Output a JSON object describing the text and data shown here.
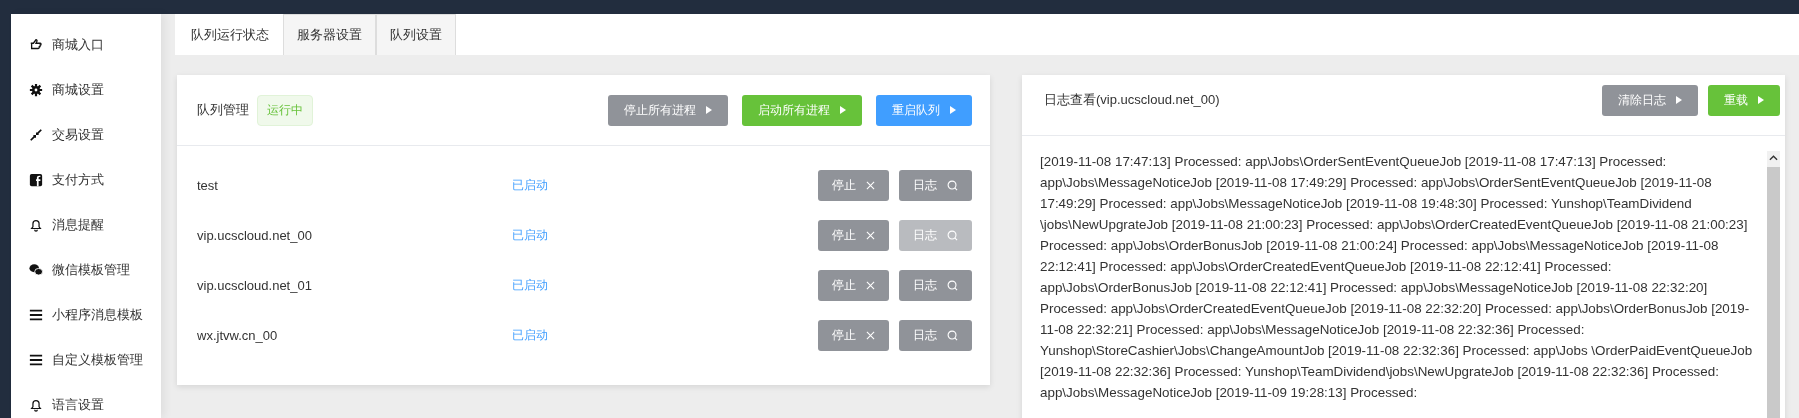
{
  "sidebar": {
    "items": [
      {
        "label": "商城入口"
      },
      {
        "label": "商城设置"
      },
      {
        "label": "交易设置"
      },
      {
        "label": "支付方式"
      },
      {
        "label": "消息提醒"
      },
      {
        "label": "微信模板管理"
      },
      {
        "label": "小程序消息模板"
      },
      {
        "label": "自定义模板管理"
      },
      {
        "label": "语言设置"
      }
    ]
  },
  "tabs": [
    {
      "label": "队列运行状态",
      "selected": true
    },
    {
      "label": "服务器设置",
      "selected": false
    },
    {
      "label": "队列设置",
      "selected": false
    }
  ],
  "queue_panel": {
    "title": "队列管理",
    "status_badge": "运行中",
    "buttons": [
      {
        "label": "停止所有进程",
        "kind": "gray"
      },
      {
        "label": "启动所有进程",
        "kind": "green"
      },
      {
        "label": "重启队列",
        "kind": "blue"
      }
    ],
    "rows": [
      {
        "name": "test",
        "status": "已启动",
        "stop_button": "停止",
        "log_button": "日志",
        "log_disabled": false
      },
      {
        "name": "vip.ucscloud.net_00",
        "status": "已启动",
        "stop_button": "停止",
        "log_button": "日志",
        "log_disabled": true
      },
      {
        "name": "vip.ucscloud.net_01",
        "status": "已启动",
        "stop_button": "停止",
        "log_button": "日志",
        "log_disabled": false
      },
      {
        "name": "wx.jtvw.cn_00",
        "status": "已启动",
        "stop_button": "停止",
        "log_button": "日志",
        "log_disabled": false
      }
    ]
  },
  "log_panel": {
    "title": "日志查看(vip.ucscloud.net_00)",
    "buttons": [
      {
        "label": "清除日志",
        "kind": "gray"
      },
      {
        "label": "重载",
        "kind": "green"
      }
    ],
    "log_text": "[2019-11-08 17:47:13] Processed: app\\Jobs\\OrderSentEventQueueJob [2019-11-08 17:47:13] Processed: app\\Jobs\\MessageNoticeJob [2019-11-08 17:49:29] Processed: app\\Jobs\\OrderSentEventQueueJob [2019-11-08 17:49:29] Processed: app\\Jobs\\MessageNoticeJob [2019-11-08 19:48:30] Processed: Yunshop\\TeamDividend \\jobs\\NewUpgrateJob [2019-11-08 21:00:23] Processed: app\\Jobs\\OrderCreatedEventQueueJob [2019-11-08 21:00:23] Processed: app\\Jobs\\OrderBonusJob [2019-11-08 21:00:24] Processed: app\\Jobs\\MessageNoticeJob [2019-11-08 22:12:41] Processed: app\\Jobs\\OrderCreatedEventQueueJob [2019-11-08 22:12:41] Processed: app\\Jobs\\OrderBonusJob [2019-11-08 22:12:41] Processed: app\\Jobs\\MessageNoticeJob [2019-11-08 22:32:20] Processed: app\\Jobs\\OrderCreatedEventQueueJob [2019-11-08 22:32:20] Processed: app\\Jobs\\OrderBonusJob [2019-11-08 22:32:21] Processed: app\\Jobs\\MessageNoticeJob [2019-11-08 22:32:36] Processed: Yunshop\\StoreCashier\\Jobs\\ChangeAmountJob [2019-11-08 22:32:36] Processed: app\\Jobs \\OrderPaidEventQueueJob [2019-11-08 22:32:36] Processed: Yunshop\\TeamDividend\\jobs\\NewUpgrateJob [2019-11-08 22:32:36] Processed: app\\Jobs\\MessageNoticeJob [2019-11-09 19:28:13] Processed:"
  }
}
